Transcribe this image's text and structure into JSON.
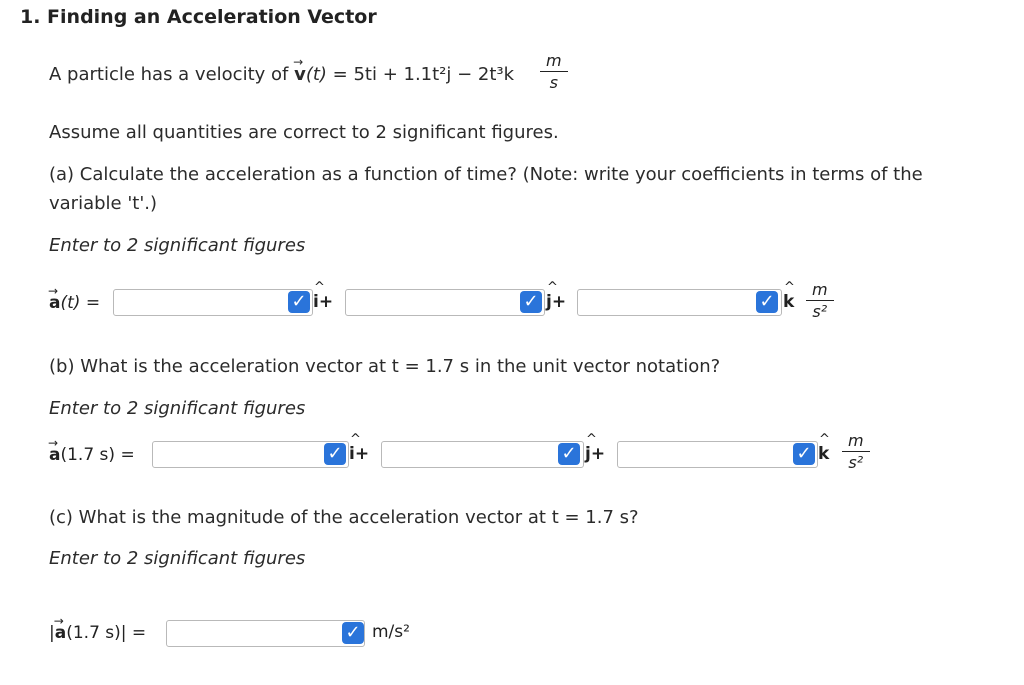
{
  "title": "1. Finding an Acceleration Vector",
  "intro": {
    "prefix": "A particle has a velocity of ",
    "vel_symbol": "v",
    "vel_arg": "(t)",
    "equation": "= 5ti + 1.1t²j − 2t³k",
    "unit_num": "m",
    "unit_den": "s"
  },
  "assumption": "Assume all quantities are correct to 2 significant figures.",
  "part_a": {
    "question_line1": "(a) Calculate the acceleration as a function of time? (Note: write your coefficients in terms of the",
    "question_line2": "variable 't'.)",
    "hint": "Enter to 2 significant figures",
    "label": "a(t) =",
    "unit_num": "m",
    "unit_den": "s²"
  },
  "part_b": {
    "question": "(b) What is the acceleration vector at t = 1.7 s in the unit vector notation?",
    "hint": "Enter to 2 significant figures",
    "label": "a(1.7 s) =",
    "unit_num": "m",
    "unit_den": "s²"
  },
  "part_c": {
    "question": "(c) What is the magnitude of the acceleration vector at t = 1.7 s?",
    "hint": "Enter to 2 significant figures",
    "label": "|a(1.7 s)| =",
    "unit": "m/s²"
  },
  "unit_vectors": {
    "i": "i",
    "j": "j",
    "k": "k",
    "plus": "+"
  },
  "icons": {
    "check": "checkmark-icon"
  },
  "colors": {
    "check_blue": "#2a74da",
    "field_border": "#b9b9b9"
  }
}
